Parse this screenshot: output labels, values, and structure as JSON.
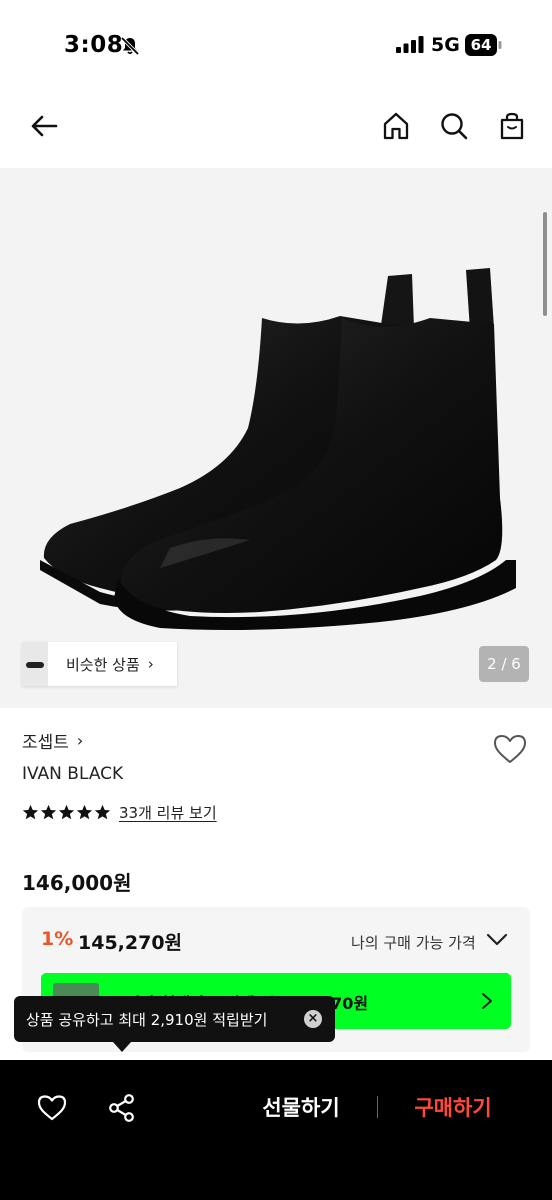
{
  "status_bar": {
    "time": "3:08",
    "network": "5G",
    "battery": "64"
  },
  "nav": {
    "icons": [
      "back-arrow-icon",
      "home-icon",
      "search-icon",
      "shopping-bag-icon"
    ]
  },
  "gallery": {
    "similar_label": "비슷한 상품",
    "chevron": "›",
    "page_counter": "2 / 6"
  },
  "product": {
    "brand": "조셉트",
    "brand_chevron": "›",
    "name": "IVAN BLACK",
    "rating_stars": 5,
    "review_link": "33개 리뷰 보기",
    "price": "146,000원"
  },
  "price_box": {
    "discount_rate": "1%",
    "discount_price": "145,270원",
    "my_price_label": "나의 구매 가능 가격",
    "promo_text": "무신사 현대카드 결제 시 118,270원"
  },
  "tooltip": {
    "text": "상품 공유하고 최대 2,910원 적립받기",
    "close": "×"
  },
  "bottom_bar": {
    "gift_label": "선물하기",
    "buy_label": "구매하기"
  },
  "colors": {
    "accent_orange": "#e8562a",
    "buy_red": "#ff4a3a",
    "promo_green": "#00ff22"
  }
}
